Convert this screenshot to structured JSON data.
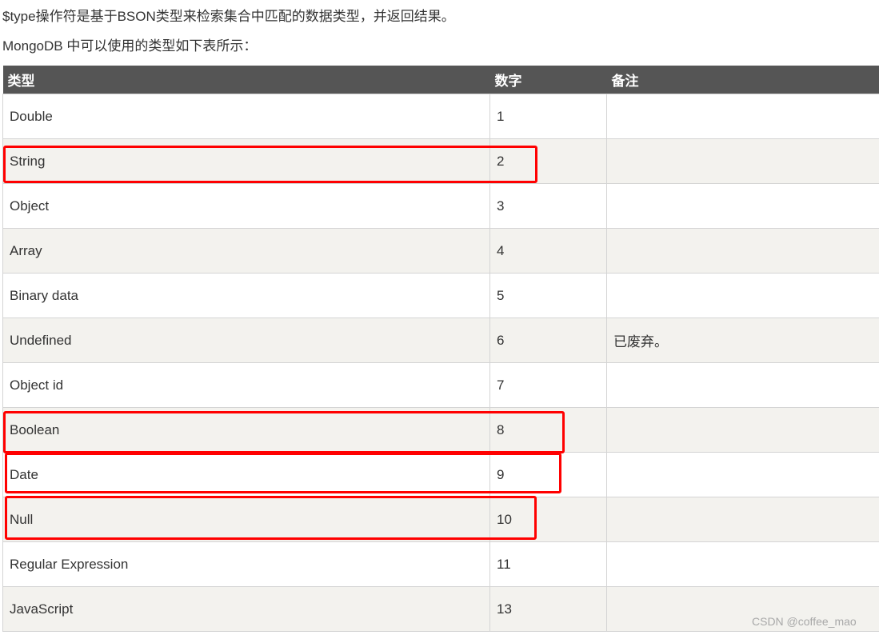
{
  "intro": {
    "line1": "$type操作符是基于BSON类型来检索集合中匹配的数据类型，并返回结果。",
    "line2": "MongoDB 中可以使用的类型如下表所示："
  },
  "table": {
    "headers": [
      "类型",
      "数字",
      "备注"
    ],
    "rows": [
      {
        "type": "Double",
        "number": "1",
        "note": ""
      },
      {
        "type": "String",
        "number": "2",
        "note": ""
      },
      {
        "type": "Object",
        "number": "3",
        "note": ""
      },
      {
        "type": "Array",
        "number": "4",
        "note": ""
      },
      {
        "type": "Binary data",
        "number": "5",
        "note": ""
      },
      {
        "type": "Undefined",
        "number": "6",
        "note": "已废弃。"
      },
      {
        "type": "Object id",
        "number": "7",
        "note": ""
      },
      {
        "type": "Boolean",
        "number": "8",
        "note": ""
      },
      {
        "type": "Date",
        "number": "9",
        "note": ""
      },
      {
        "type": "Null",
        "number": "10",
        "note": ""
      },
      {
        "type": "Regular Expression",
        "number": "11",
        "note": ""
      },
      {
        "type": "JavaScript",
        "number": "13",
        "note": ""
      }
    ]
  },
  "highlights": [
    "String",
    "Boolean",
    "Date",
    "Null"
  ],
  "colors": {
    "header_bg": "#555555",
    "row_alt_bg": "#f3f2ee",
    "highlight": "#ff0000"
  },
  "watermark": "CSDN @coffee_mao"
}
